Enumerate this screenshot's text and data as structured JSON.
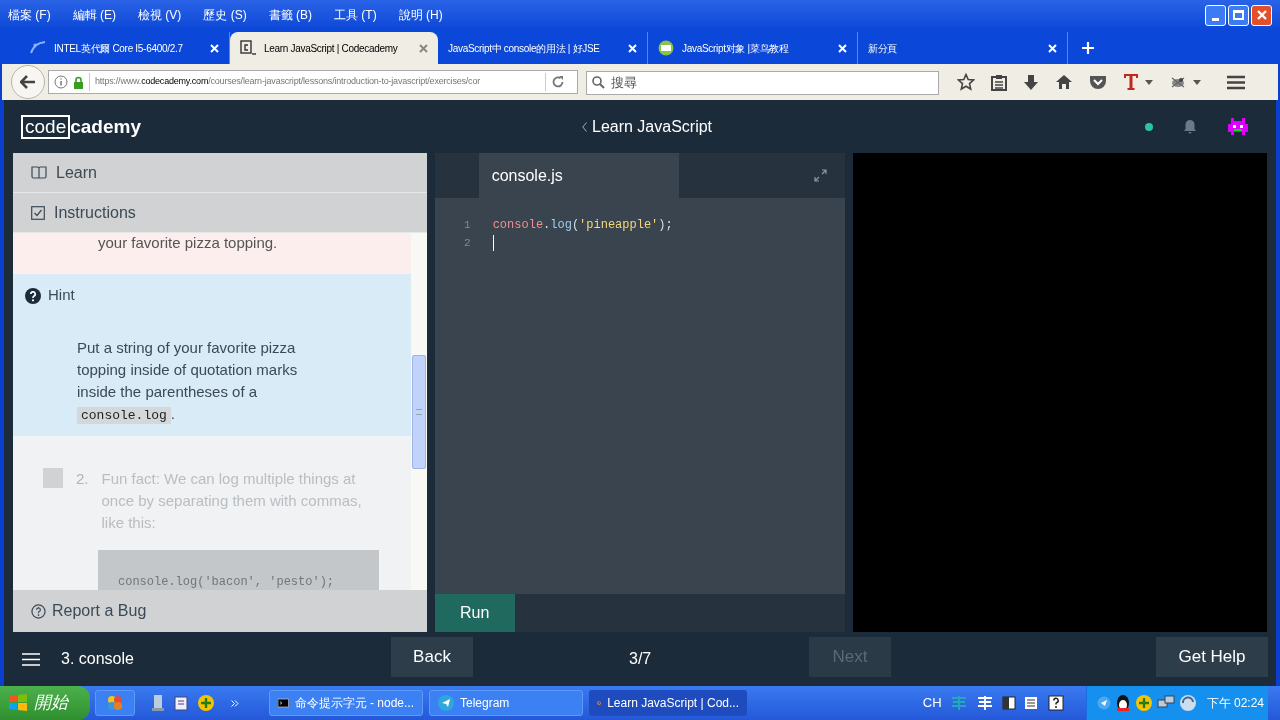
{
  "menu": [
    "檔案 (F)",
    "編輯 (E)",
    "檢視 (V)",
    "歷史 (S)",
    "書籤 (B)",
    "工具 (T)",
    "說明 (H)"
  ],
  "tabs": [
    {
      "label": "INTEL英代爾 Core I5-6400/2.7",
      "selected": false
    },
    {
      "label": "Learn JavaScript | Codecademy",
      "selected": true
    },
    {
      "label": "JavaScript中 console的用法 | 好JSE",
      "selected": false
    },
    {
      "label": "JavaScript对象 |菜鸟教程",
      "selected": false
    },
    {
      "label": "新分頁",
      "selected": false
    }
  ],
  "address": {
    "url": "https://www.**codecademy.com**/courses/learn-javascript/lessons/introduction-to-javascript/exercises/cor"
  },
  "search": {
    "placeholder": "搜尋"
  },
  "header": {
    "logo_box": "code",
    "logo_rest": "cademy",
    "title": "Learn JavaScript"
  },
  "panel": {
    "sections": [
      "Learn",
      "Instructions"
    ],
    "previous_text": "your favorite pizza topping.",
    "hint": {
      "title": "Hint",
      "text_before": "Put a string of your favorite pizza topping inside of quotation marks inside the parentheses of a ",
      "code": "console.log",
      "text_after": "."
    },
    "step": {
      "number": "2.",
      "checked": false,
      "text": "Fun fact: We can log multiple things at once by separating them with commas, like this:",
      "code": "console.log('bacon', 'pesto');"
    },
    "report": "Report a Bug"
  },
  "editor": {
    "file_tab": "console.js",
    "lines": [
      {
        "number": "1",
        "cursor": false,
        "tokens": [
          {
            "kind": "object",
            "text": "console"
          },
          {
            "kind": "punct",
            "text": "."
          },
          {
            "kind": "method",
            "text": "log"
          },
          {
            "kind": "punct",
            "text": "("
          },
          {
            "kind": "string",
            "text": "'pineapple'"
          },
          {
            "kind": "punct",
            "text": ");"
          }
        ]
      },
      {
        "number": "2",
        "cursor": true
      }
    ],
    "run": "Run"
  },
  "bottom": {
    "lesson": "3. console",
    "back": "Back",
    "progress": "3/7",
    "next": {
      "label": "Next",
      "disabled": true
    },
    "help": "Get Help"
  },
  "taskbar": {
    "start": "開始",
    "tasks": [
      {
        "label": "命令提示字元 - node...",
        "selected": false
      },
      {
        "label": "Telegram",
        "selected": false
      },
      {
        "label": "Learn JavaScript | Cod...",
        "selected": true
      }
    ],
    "language": "CH",
    "clock": "下午 02:24"
  }
}
